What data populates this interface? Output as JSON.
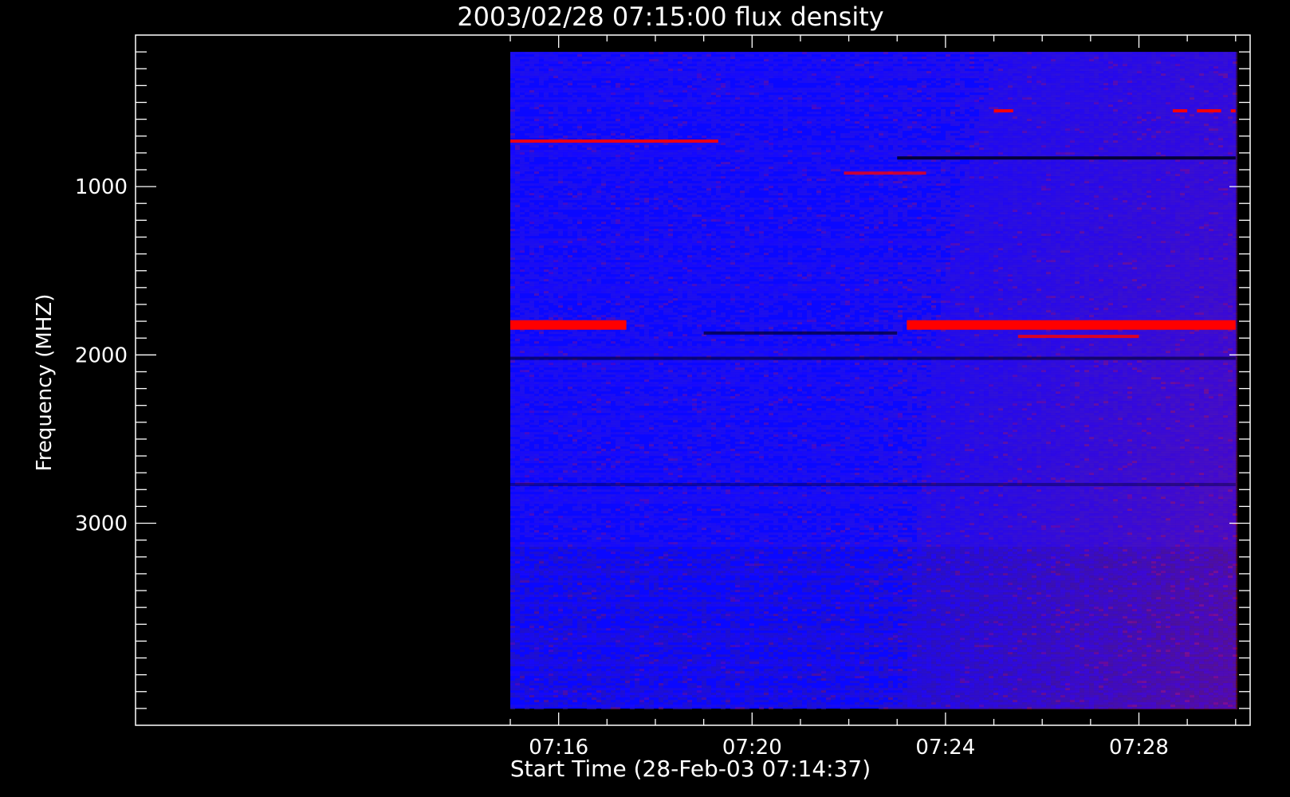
{
  "chart_data": {
    "type": "heatmap",
    "title": "2003/02/28 07:15:00 flux density",
    "xlabel": "Start Time (28-Feb-03 07:14:37)",
    "ylabel": "Frequency (MHZ)",
    "x_range_minutes": [
      7.25,
      30.3
    ],
    "data_x_range_minutes": [
      15,
      30
    ],
    "y_range_mhz": [
      100,
      4200
    ],
    "data_y_range_mhz": [
      200,
      4100
    ],
    "y_inverted": true,
    "x_ticks": [
      {
        "value": 16,
        "label": "07:16"
      },
      {
        "value": 20,
        "label": "07:20"
      },
      {
        "value": 24,
        "label": "07:24"
      },
      {
        "value": 28,
        "label": "07:28"
      }
    ],
    "y_ticks": [
      {
        "value": 1000,
        "label": "1000"
      },
      {
        "value": 2000,
        "label": "2000"
      },
      {
        "value": 3000,
        "label": "3000"
      }
    ],
    "colormap": [
      "#000000",
      "#1a10ff",
      "#4414d0",
      "#7a1060",
      "#ff0000"
    ],
    "background_color": "#0a08ff",
    "bands": [
      {
        "freq_mhz": 1822,
        "intensity": 1.0,
        "segments_minutes": [
          [
            15,
            17.4
          ],
          [
            23.2,
            30
          ]
        ]
      },
      {
        "freq_mhz": 730,
        "intensity": 0.8,
        "segments_minutes": [
          [
            15,
            19.3
          ]
        ]
      },
      {
        "freq_mhz": 550,
        "intensity": 0.9,
        "segments_minutes": [
          [
            25.0,
            25.4
          ],
          [
            28.7,
            29.0
          ],
          [
            29.2,
            29.7
          ],
          [
            29.9,
            30
          ]
        ]
      },
      {
        "freq_mhz": 1890,
        "intensity": 0.6,
        "segments_minutes": [
          [
            25.5,
            28.0
          ]
        ]
      },
      {
        "freq_mhz": 2020,
        "intensity": -0.6,
        "segments_minutes": [
          [
            15,
            30
          ]
        ]
      },
      {
        "freq_mhz": 1870,
        "intensity": -0.7,
        "segments_minutes": [
          [
            19,
            23
          ]
        ]
      },
      {
        "freq_mhz": 830,
        "intensity": -0.9,
        "segments_minutes": [
          [
            23,
            30
          ]
        ]
      },
      {
        "freq_mhz": 920,
        "intensity": 0.5,
        "segments_minutes": [
          [
            21.9,
            23.6
          ]
        ]
      },
      {
        "freq_mhz": 2770,
        "intensity": -0.4,
        "segments_minutes": [
          [
            15,
            30
          ]
        ]
      }
    ]
  }
}
